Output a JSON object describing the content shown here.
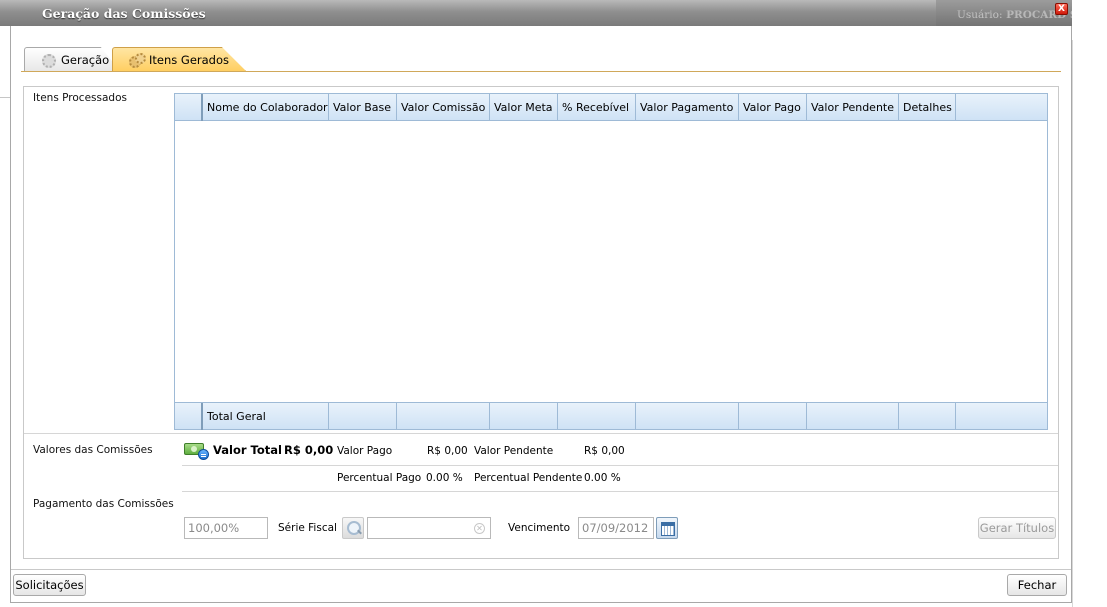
{
  "window": {
    "title": "Geração das Comissões",
    "user_label": "Usuário:",
    "user_name": "PROCARD S",
    "close_label": "X"
  },
  "tabs": [
    {
      "label": "Geração",
      "active": false,
      "icon": "gear-icon"
    },
    {
      "label": "Itens Gerados",
      "active": true,
      "icon": "gears-icon"
    }
  ],
  "sections": {
    "itens_processados": "Itens Processados",
    "valores_comissoes": "Valores das Comissões",
    "pagamento_comissoes": "Pagamento das Comissões"
  },
  "grid": {
    "columns": [
      "Nome do Colaborador",
      "Valor Base",
      "Valor Comissão",
      "Valor Meta",
      "% Recebível",
      "Valor Pagamento",
      "Valor Pago",
      "Valor Pendente",
      "Detalhes"
    ],
    "rows": [],
    "footer": {
      "label": "Total Geral",
      "values": [
        "",
        "",
        "",
        "",
        "",
        "",
        "",
        ""
      ]
    }
  },
  "valores": {
    "valor_total_label": "Valor Total",
    "valor_total": "R$ 0,00",
    "valor_pago_label": "Valor Pago",
    "valor_pago": "R$ 0,00",
    "valor_pendente_label": "Valor Pendente",
    "valor_pendente": "R$ 0,00",
    "percentual_pago_label": "Percentual Pago",
    "percentual_pago": "0.00 %",
    "percentual_pendente_label": "Percentual Pendente",
    "percentual_pendente": "0.00 %"
  },
  "pagamento": {
    "percentual_value": "100,00%",
    "serie_fiscal_label": "Série Fiscal",
    "serie_fiscal_value": "",
    "vencimento_label": "Vencimento",
    "vencimento_value": "07/09/2012",
    "gerar_titulos_label": "Gerar Títulos"
  },
  "footer_buttons": {
    "solicitacoes": "Solicitações",
    "fechar": "Fechar"
  },
  "colors": {
    "grid_header": "#cfe2f5",
    "active_tab": "#ffcf62",
    "title_bar": "#8f8f8f"
  }
}
